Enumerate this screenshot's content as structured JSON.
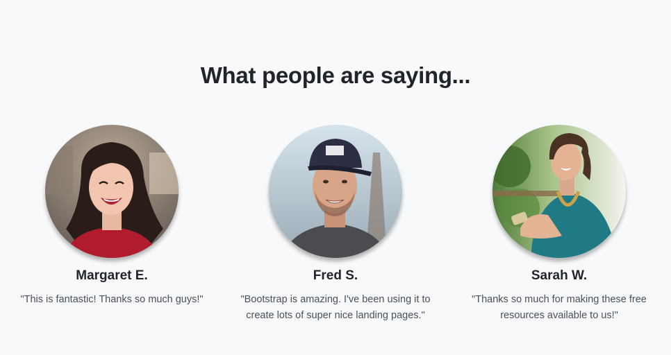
{
  "section": {
    "title": "What people are saying..."
  },
  "testimonials": [
    {
      "name": "Margaret E.",
      "quote": "\"This is fantastic! Thanks so much guys!\"",
      "avatar_icon": "woman-smiling-photo"
    },
    {
      "name": "Fred S.",
      "quote": "\"Bootstrap is amazing. I've been using it to create lots of super nice landing pages.\"",
      "avatar_icon": "man-with-cap-photo"
    },
    {
      "name": "Sarah W.",
      "quote": "\"Thanks so much for making these free resources available to us!\"",
      "avatar_icon": "woman-with-phone-photo"
    }
  ],
  "colors": {
    "background": "#f8f9fa",
    "heading": "#212529",
    "text": "#495057"
  }
}
